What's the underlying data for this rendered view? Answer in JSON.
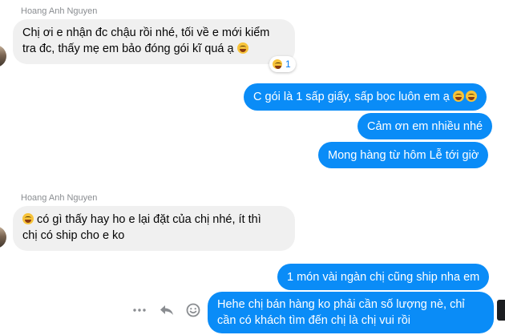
{
  "conversation": {
    "group1": {
      "sender": "Hoang Anh Nguyen",
      "message": {
        "line1": "Chị ơi e nhận đc chậu rồi nhé, tối về e mới kiểm",
        "line2": "tra đc, thấy mẹ em bảo đóng gói kĩ quá ạ"
      },
      "reaction_count": "1"
    },
    "outgoing1": {
      "m1": "C gói là 1 sấp giấy, sấp bọc luôn em ạ",
      "m2": "Cảm ơn em nhiều nhé",
      "m3": "Mong hàng từ hôm Lễ tới giờ"
    },
    "group2": {
      "sender": "Hoang Anh Nguyen",
      "message": {
        "line1": "có gì thấy hay ho e lại đặt của chị nhé, ít thì",
        "line2": "chị có ship cho e ko"
      }
    },
    "outgoing2": {
      "m1": "1 món vài ngàn chị cũng ship nha em",
      "m2_line1": "Hehe chị bán hàng ko phải cần số lượng nè, chỉ",
      "m2_line2": "cần có khách tìm đến chị là chị vui rồi"
    }
  },
  "icons": {
    "more": "more-options-icon",
    "reply": "reply-icon",
    "react": "emoji-react-icon"
  },
  "colors": {
    "outgoing_bubble": "#0a8cf7",
    "incoming_bubble": "#f0f0f0"
  }
}
